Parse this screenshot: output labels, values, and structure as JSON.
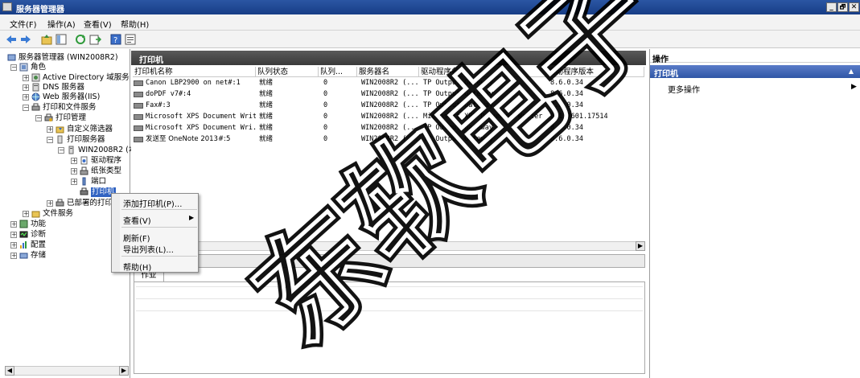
{
  "window": {
    "title": "服务器管理器",
    "buttons": [
      "_",
      "🗗",
      "✕"
    ]
  },
  "menu": [
    "文件(F)",
    "操作(A)",
    "查看(V)",
    "帮助(H)"
  ],
  "tree": {
    "root": "服务器管理器 (WIN2008R2)",
    "roles": "角色",
    "ad": "Active Directory 域服务",
    "dns": "DNS 服务器",
    "iis": "Web 服务器(IIS)",
    "print_file": "打印和文件服务",
    "print_mgmt": "打印管理",
    "custom_filters": "自定义筛选器",
    "print_servers": "打印服务器",
    "server": "WIN2008R2 (本",
    "drivers": "驱动程序",
    "forms": "纸张类型",
    "ports": "端口",
    "printers": "打印机",
    "deployed": "已部署的打印",
    "file_services": "文件服务",
    "features": "功能",
    "diagnostics": "诊断",
    "config": "配置",
    "storage": "存储"
  },
  "center": {
    "header": "打印机",
    "columns": [
      "打印机名称",
      "队列状态",
      "队列...",
      "服务器名",
      "驱动程序名",
      "驱动程序版本"
    ],
    "rows": [
      [
        "Canon LBP2900 on net#:1",
        "就绪",
        "0",
        "WIN2008R2 (...",
        "TP Output Gateway",
        "8.6.0.34"
      ],
      [
        "doPDF v7#:4",
        "就绪",
        "0",
        "WIN2008R2 (...",
        "TP Output Gateway",
        "8.6.0.34"
      ],
      [
        "Fax#:3",
        "就绪",
        "0",
        "WIN2008R2 (...",
        "TP Output Gateway",
        "8.6.0.34"
      ],
      [
        "Microsoft XPS Document Writer",
        "就绪",
        "0",
        "WIN2008R2 (...",
        "Microsoft XPS Document Writer",
        "6.1.7601.17514"
      ],
      [
        "Microsoft XPS Document Wri...",
        "就绪",
        "0",
        "WIN2008R2 (...",
        "TP Output Gateway",
        "8.6.0.34"
      ],
      [
        "发送至 OneNote 2013#:5",
        "就绪",
        "0",
        "WIN2008R2 (...",
        "TP Output Gateway",
        "8.6.0.34"
      ]
    ],
    "lower_tab": "作业"
  },
  "actions": {
    "title": "操作",
    "section": "打印机",
    "more": "更多操作"
  },
  "context_menu": {
    "add_printer": "添加打印机(P)...",
    "view": "查看(V)",
    "refresh": "刷新(F)",
    "export": "导出列表(L)...",
    "help": "帮助(H)"
  },
  "watermark": "东软电子"
}
